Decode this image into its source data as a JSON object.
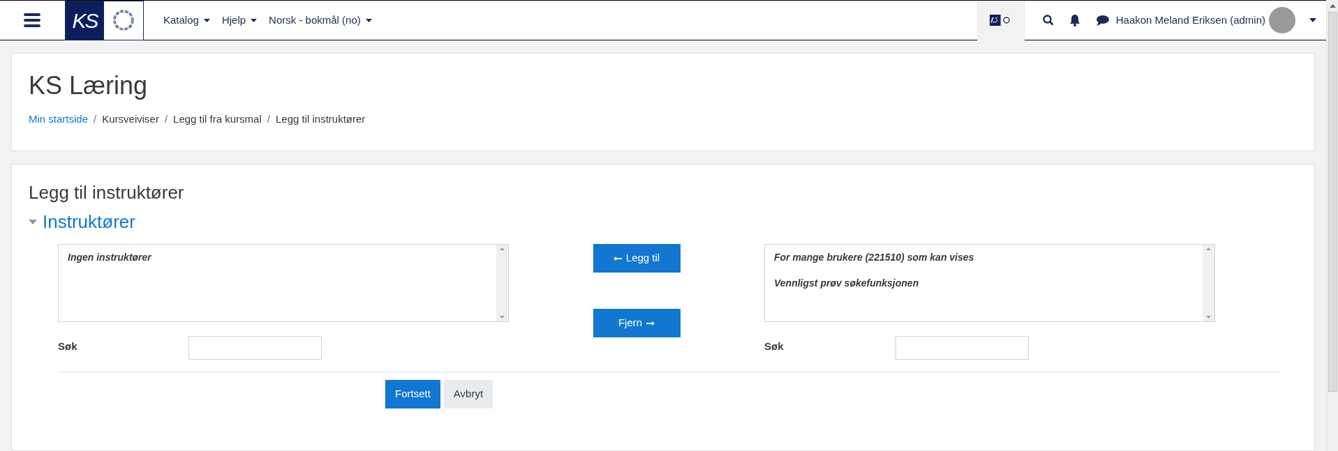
{
  "navbar": {
    "menus": [
      {
        "label": "Katalog"
      },
      {
        "label": "Hjelp"
      },
      {
        "label": "Norsk - bokmål (no)"
      }
    ],
    "logo_text": "KS",
    "user_name": "Haakon Meland Eriksen (admin)"
  },
  "header": {
    "title": "KS Læring",
    "separator": "/",
    "breadcrumb": [
      {
        "label": "Min startside",
        "link": true
      },
      {
        "label": "Kursveiviser",
        "link": false
      },
      {
        "label": "Legg til fra kursmal",
        "link": false
      },
      {
        "label": "Legg til instruktører",
        "link": false
      }
    ]
  },
  "page_heading": "Legg til instruktører",
  "section": {
    "title": "Instruktører",
    "expanded": true
  },
  "current_list": {
    "messages": [
      "Ingen instruktører"
    ],
    "search_label": "Søk"
  },
  "add_button": {
    "label": "Legg til"
  },
  "remove_button": {
    "label": "Fjern"
  },
  "potential_list": {
    "messages": [
      "For mange brukere (221510) som kan vises",
      "Vennligst prøv søkefunksjonen"
    ],
    "search_label": "Søk"
  },
  "buttons": [
    {
      "label": "Fortsett",
      "kind": "primary"
    },
    {
      "label": "Avbryt",
      "kind": "secondary"
    }
  ]
}
